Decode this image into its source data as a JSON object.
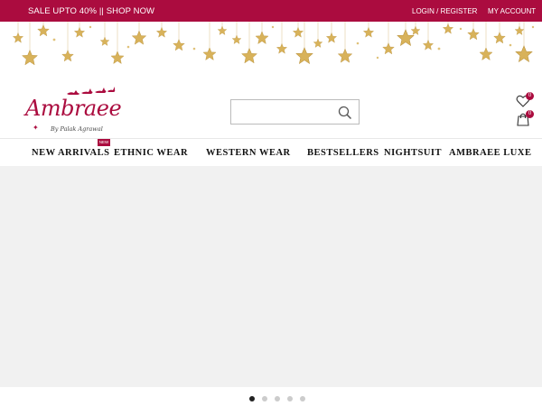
{
  "topbar": {
    "promo": "SALE UPTO 40% || SHOP NOW",
    "login": "LOGIN / REGISTER",
    "account": "MY ACCOUNT"
  },
  "brand": {
    "name": "Ambraee",
    "byline": "By Palak Agrawal",
    "accent_color": "#ab0c3f"
  },
  "search": {
    "placeholder": "",
    "icon": "search-icon"
  },
  "header_icons": {
    "wishlist": {
      "icon": "heart-icon",
      "count": "0"
    },
    "cart": {
      "icon": "shopping-bag-icon",
      "count": "0"
    }
  },
  "nav": {
    "items": [
      {
        "label": "NEW ARRIVALS",
        "tag": "NEW"
      },
      {
        "label": "ETHNIC WEAR"
      },
      {
        "label": "WESTERN WEAR"
      },
      {
        "label": "BESTSELLERS"
      },
      {
        "label": "NIGHTSUIT"
      },
      {
        "label": "AMBRAEE LUXE"
      }
    ]
  },
  "slider": {
    "slide_count": 5,
    "active_index": 0
  }
}
